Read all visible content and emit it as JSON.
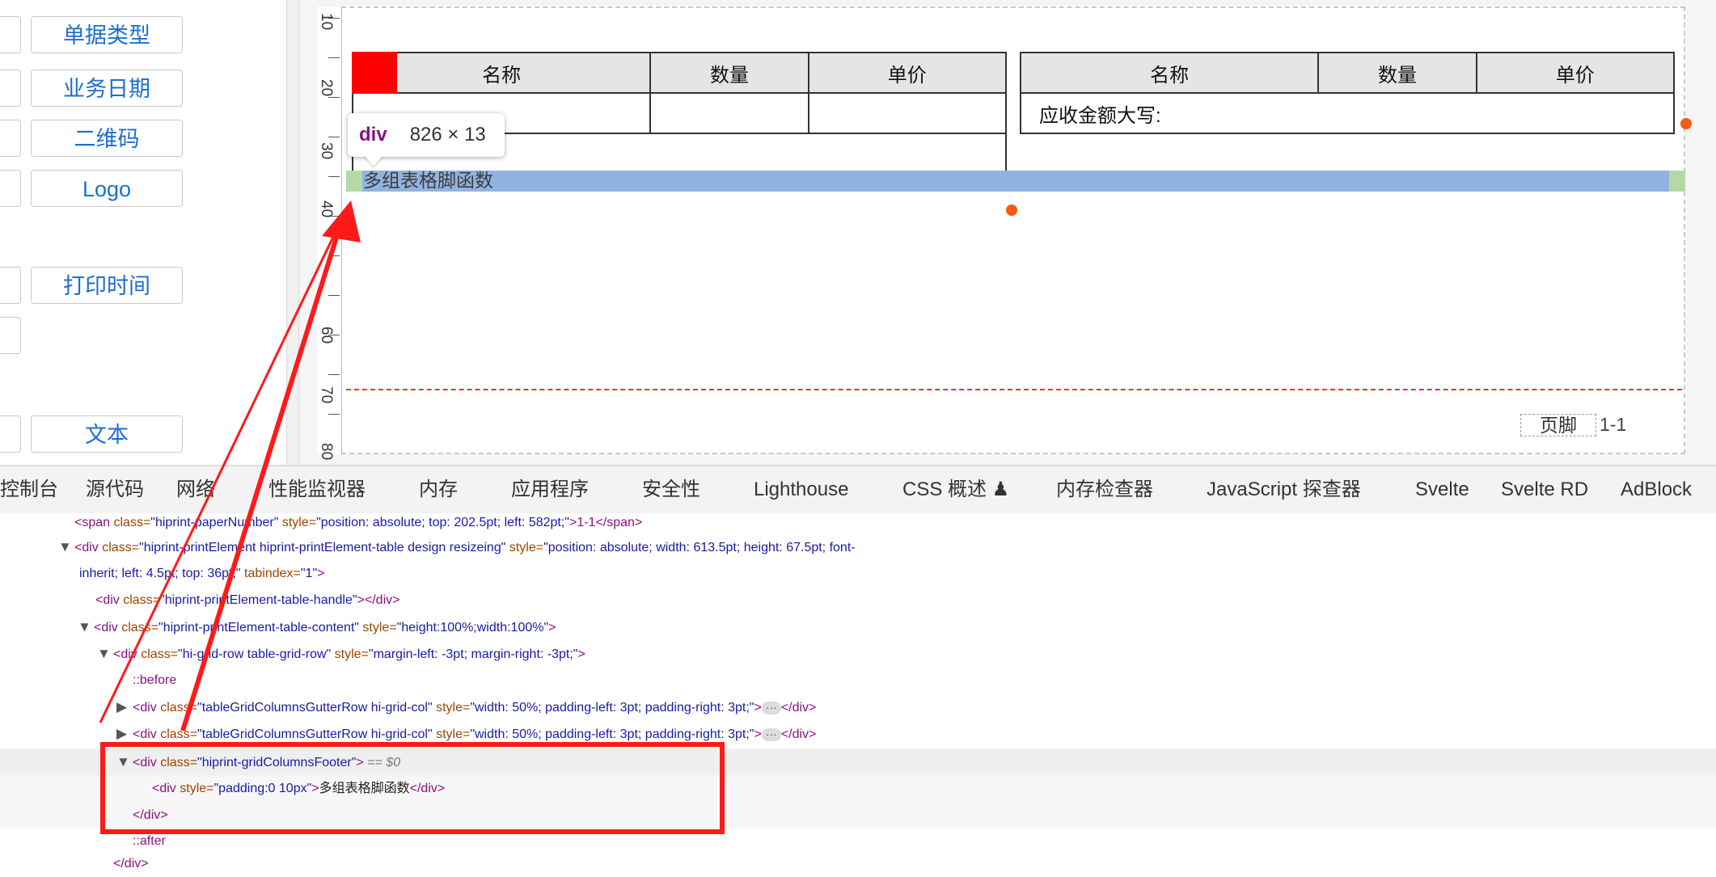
{
  "left_panel": {
    "buttons": [
      {
        "label": "单据类型"
      },
      {
        "label": "业务日期"
      },
      {
        "label": "二维码"
      },
      {
        "label": "Logo"
      },
      {
        "label": "打印时间"
      },
      {
        "label": "文本"
      }
    ]
  },
  "ruler": {
    "labels": [
      "10",
      "20",
      "30",
      "40",
      "50",
      "60",
      "70",
      "80"
    ]
  },
  "design": {
    "table_left": {
      "headers": [
        "名称",
        "数量",
        "单价"
      ],
      "row1": [
        "",
        "",
        ""
      ]
    },
    "table_right": {
      "headers": [
        "名称",
        "数量",
        "单价"
      ],
      "row1_text": "应收金额大写:"
    },
    "tooltip": {
      "tag": "div",
      "size": "826 × 13"
    },
    "footer_text": "多组表格脚函数",
    "page_footer_label": "页脚",
    "page_number": "1-1"
  },
  "devtools": {
    "tabs": [
      "控制台",
      "源代码",
      "网络",
      "性能监视器",
      "内存",
      "应用程序",
      "安全性",
      "Lighthouse",
      "CSS 概述 ♟",
      "内存检查器",
      "JavaScript 探查器",
      "Svelte",
      "Svelte RD",
      "AdBlock"
    ],
    "lines": {
      "l0_tag": "<span",
      "l0_attr": " class=",
      "l0_val": "\"hiprint-paperNumber\"",
      "l0_attr2": " style=",
      "l0_val2": "\"position: absolute; top: 202.5pt; left: 582pt;\"",
      "l0_txt": ">1-1</span>",
      "l1_tag": "<div",
      "l1_attr": " class=",
      "l1_val": "\"hiprint-printElement hiprint-printElement-table design resizeing\"",
      "l1_attr2": " style=",
      "l1_val2": "\"position: absolute; width: 613.5pt; height: 67.5pt; font-",
      "l2_val": "inherit; left: 4.5pt; top: 36pt;\"",
      "l2_attr": " tabindex=",
      "l2_val2": "\"1\"",
      "l2_tag": ">",
      "l3_tag": "<div",
      "l3_attr": " class=",
      "l3_val": "\"hiprint-printElement-table-handle\"",
      "l3_tag2": "></div>",
      "l4_tag": "<div",
      "l4_attr": " class=",
      "l4_val": "\"hiprint-printElement-table-content\"",
      "l4_attr2": " style=",
      "l4_val2": "\"height:100%;width:100%\"",
      "l4_tag2": ">",
      "l5_tag": "<div",
      "l5_attr": " class=",
      "l5_val": "\"hi-grid-row table-grid-row\"",
      "l5_attr2": " style=",
      "l5_val2": "\"margin-left: -3pt; margin-right: -3pt;\"",
      "l5_tag2": ">",
      "l6_pseudo": "::before",
      "l7_tag": "<div",
      "l7_attr": " class=",
      "l7_val": "\"tableGridColumnsGutterRow hi-grid-col\"",
      "l7_attr2": " style=",
      "l7_val2": "\"width: 50%; padding-left: 3pt; padding-right: 3pt;\"",
      "l7_tag2": ">",
      "l7_tag3": "</div>",
      "l8_tag": "<div",
      "l8_attr": " class=",
      "l8_val": "\"tableGridColumnsGutterRow hi-grid-col\"",
      "l8_attr2": " style=",
      "l8_val2": "\"width: 50%; padding-left: 3pt; padding-right: 3pt;\"",
      "l8_tag2": ">",
      "l8_tag3": "</div>",
      "l9_tag": "<div",
      "l9_attr": " class=",
      "l9_val": "\"hiprint-gridColumnsFooter\"",
      "l9_tag2": ">",
      "l9_eq": " == $0",
      "l10_tag": "<div",
      "l10_attr": " style=",
      "l10_val": "\"padding:0 10px\"",
      "l10_tag2": ">",
      "l10_txt": "多组表格脚函数",
      "l10_tag3": "</div>",
      "l11_tag": "</div>",
      "l12_pseudo": "::after",
      "l13_tag": "</div>"
    }
  },
  "colors": {
    "accent_blue": "#1c6fd0",
    "highlight_red": "#ff1a1a",
    "footer_highlight": "#91b3e0",
    "handle_orange": "#f45b13"
  }
}
